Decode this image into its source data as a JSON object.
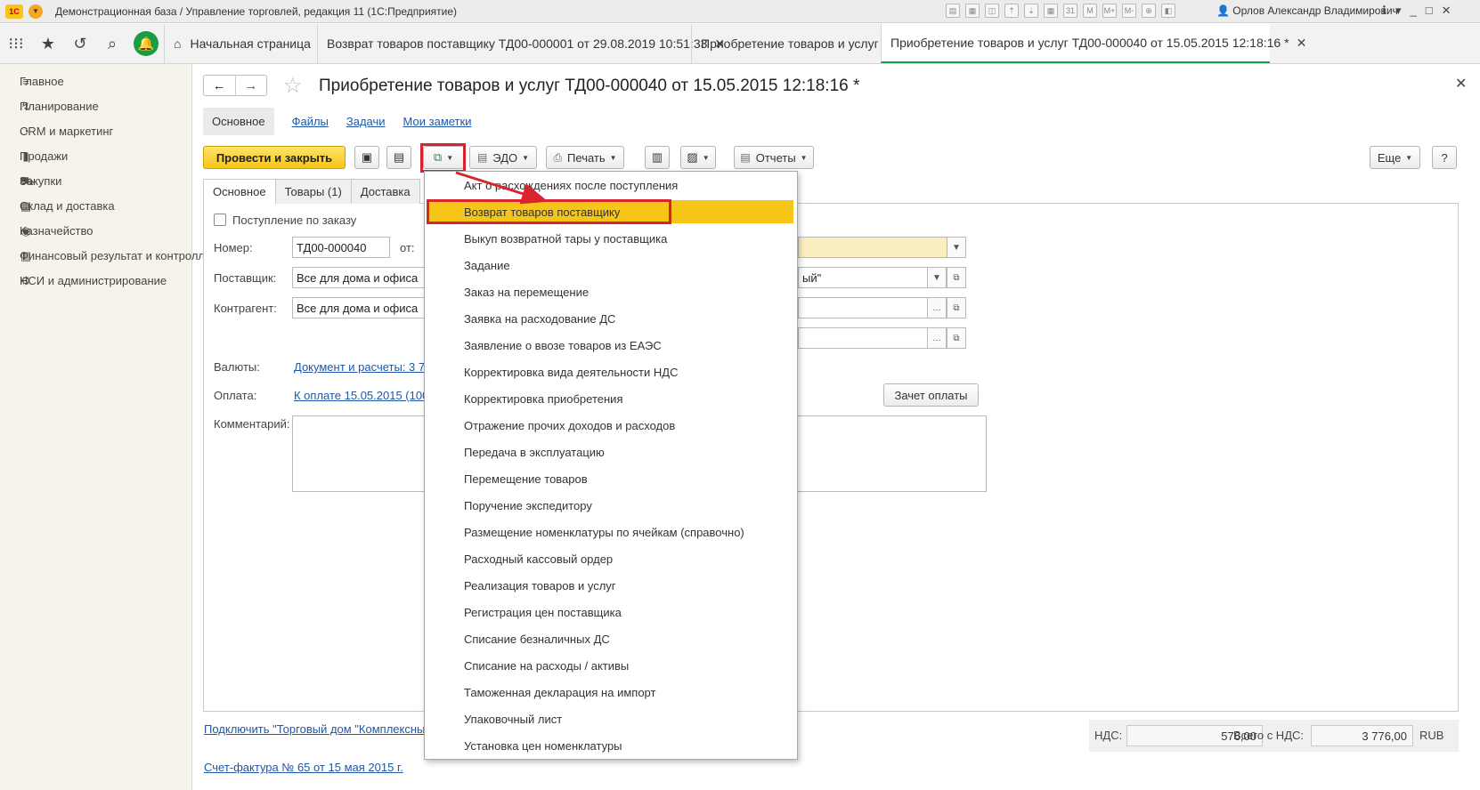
{
  "titlebar": {
    "logo": "1С",
    "text": "Демонстрационная база / Управление торговлей, редакция 11  (1С:Предприятие)",
    "user": "Орлов Александр Владимирович",
    "icons": [
      "save-icon",
      "print-icon",
      "preview-icon",
      "upload-icon",
      "download-icon",
      "calc-icon",
      "calendar-icon",
      "m-icon",
      "m-plus-icon",
      "m-minus-icon",
      "zoom-icon",
      "panel-icon"
    ],
    "window_controls": [
      "_",
      "□",
      "✕"
    ],
    "calendar_day": "31"
  },
  "tabs": [
    {
      "label": "Начальная страница",
      "closable": false
    },
    {
      "label": "Возврат товаров поставщику ТД00-000001 от 29.08.2019 10:51:33",
      "closable": true
    },
    {
      "label": "Приобретение товаров и услуг",
      "closable": true
    },
    {
      "label": "Приобретение товаров и услуг ТД00-000040 от 15.05.2015 12:18:16 *",
      "closable": true
    }
  ],
  "sidebar": {
    "items": [
      {
        "label": "Главное",
        "icon": "menu-icon"
      },
      {
        "label": "Планирование",
        "icon": "planning-icon"
      },
      {
        "label": "CRM и маркетинг",
        "icon": "crm-icon"
      },
      {
        "label": "Продажи",
        "icon": "sales-icon"
      },
      {
        "label": "Закупки",
        "icon": "cart-icon"
      },
      {
        "label": "Склад и доставка",
        "icon": "warehouse-icon"
      },
      {
        "label": "Казначейство",
        "icon": "treasury-icon"
      },
      {
        "label": "Финансовый результат и контроллинг",
        "icon": "chart-icon"
      },
      {
        "label": "НСИ и администрирование",
        "icon": "gear-icon"
      }
    ]
  },
  "form": {
    "title": "Приобретение товаров и услуг ТД00-000040 от 15.05.2015 12:18:16 *",
    "subnav": [
      "Основное",
      "Файлы",
      "Задачи",
      "Мои заметки"
    ],
    "toolbar": {
      "post_close": "Провести и закрыть",
      "edo": "ЭДО",
      "print": "Печать",
      "reports": "Отчеты",
      "more": "Еще",
      "help": "?"
    },
    "inner_tabs": [
      "Основное",
      "Товары (1)",
      "Доставка"
    ],
    "fields": {
      "by_order_label": "Поступление по заказу",
      "number_label": "Номер:",
      "number_value": "ТД00-000040",
      "date_label": "от:",
      "supplier_label": "Поставщик:",
      "supplier_value": "Все для дома и офиса",
      "supplier_right_value": "ый\"",
      "counterparty_label": "Контрагент:",
      "counterparty_value": "Все для дома и офиса",
      "currency_label": "Валюты:",
      "currency_link": "Документ и расчеты: 3 7",
      "payment_label": "Оплата:",
      "payment_link": "К оплате 15.05.2015 (100",
      "comment_label": "Комментарий:",
      "offset_button": "Зачет оплаты"
    },
    "footer": {
      "connect_link": "Подключить \"Торговый дом \"Комплексный",
      "invoice_link": "Счет-фактура № 65 от 15 мая 2015 г.",
      "vat_label": "НДС:",
      "vat_value": "576,00",
      "total_label": "Всего с НДС:",
      "total_value": "3 776,00",
      "currency": "RUB"
    }
  },
  "dropdown": {
    "selected_index": 1,
    "items": [
      "Акт о расхождениях после поступления",
      "Возврат товаров поставщику",
      "Выкуп возвратной тары у поставщика",
      "Задание",
      "Заказ на перемещение",
      "Заявка на расходование ДС",
      "Заявление о ввозе товаров из ЕАЭС",
      "Корректировка вида деятельности НДС",
      "Корректировка приобретения",
      "Отражение прочих доходов и расходов",
      "Передача в эксплуатацию",
      "Перемещение товаров",
      "Поручение экспедитору",
      "Размещение номенклатуры по ячейкам (справочно)",
      "Расходный кассовый ордер",
      "Реализация товаров и услуг",
      "Регистрация цен поставщика",
      "Списание безналичных ДС",
      "Списание на расходы / активы",
      "Таможенная декларация на импорт",
      "Упаковочный лист",
      "Установка цен номенклатуры"
    ]
  },
  "colors": {
    "accent_green": "#1a9b45",
    "primary_yellow": "#f5c518",
    "highlight_red": "#d9232d",
    "link_blue": "#2056a8"
  }
}
